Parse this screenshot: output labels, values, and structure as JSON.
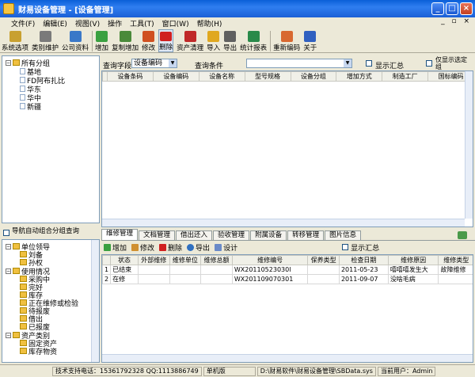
{
  "window": {
    "title": "财易设备管理 - [设备管理]"
  },
  "menu": [
    "文件(F)",
    "编辑(E)",
    "视图(V)",
    "操作",
    "工具(T)",
    "窗口(W)",
    "帮助(H)"
  ],
  "toolbar": [
    {
      "label": "系统选项",
      "icon": "gear-icon",
      "color": "#c8a030"
    },
    {
      "label": "类别维护",
      "icon": "tools-icon",
      "color": "#7a7a7a"
    },
    {
      "label": "公司资料",
      "icon": "people-icon",
      "color": "#3a78c8"
    },
    {
      "label": "增加",
      "icon": "add-icon",
      "color": "#3aa040"
    },
    {
      "label": "复制增加",
      "icon": "copy-icon",
      "color": "#4a8a3a"
    },
    {
      "label": "修改",
      "icon": "pen-icon",
      "color": "#d05020"
    },
    {
      "label": "删除",
      "icon": "delete-icon",
      "color": "#d02020"
    },
    {
      "label": "资产清理",
      "icon": "clear-icon",
      "color": "#c02828"
    },
    {
      "label": "导入",
      "icon": "import-icon",
      "color": "#e0a820"
    },
    {
      "label": "导出",
      "icon": "export-icon",
      "color": "#606060"
    },
    {
      "label": "统计报表",
      "icon": "chart-icon",
      "color": "#2a8a4a"
    },
    {
      "label": "重新编码",
      "icon": "recode-icon",
      "color": "#d86830"
    },
    {
      "label": "关于",
      "icon": "help-icon",
      "color": "#3060c0"
    }
  ],
  "tree_top": {
    "root": "所有分组",
    "children": [
      "基地",
      "FD阿布扎比",
      "华东",
      "华中",
      "新疆"
    ]
  },
  "query": {
    "field_label": "查询字段",
    "field_value": "设备编码",
    "cond_label": "查询条件",
    "cond_value": "",
    "summary_label": "显示汇总",
    "only_selected_label": "仅显示选定组"
  },
  "main_table": {
    "columns": [
      "设备条码",
      "设备编码",
      "设备名称",
      "型号规格",
      "设备分组",
      "增加方式",
      "制造工厂",
      "国标编码"
    ]
  },
  "left_bottom": {
    "nav_label": "导航自动组合分组查询",
    "groups": [
      {
        "name": "单位领导",
        "items": [
          "刘备",
          "孙权"
        ]
      },
      {
        "name": "使用情况",
        "items": [
          "采购中",
          "完好",
          "库存",
          "正在维修或检验",
          "待报废",
          "借出",
          "已报废"
        ]
      },
      {
        "name": "资产类别",
        "items": [
          "固定资产",
          "库存物资"
        ]
      }
    ]
  },
  "tabs": [
    "维修管理",
    "文档管理",
    "借出还入",
    "验收管理",
    "附属设备",
    "转移管理",
    "图片信息"
  ],
  "sub_toolbar": [
    "增加",
    "修改",
    "删除",
    "导出",
    "设计"
  ],
  "sub_summary_label": "显示汇总",
  "repair_table": {
    "columns": [
      "状态",
      "外部维修",
      "维修单位",
      "维修总额",
      "维修编号",
      "保养类型",
      "检查日期",
      "维修原因",
      "维修类型"
    ],
    "rows": [
      {
        "no": "1",
        "cells": [
          "已结束",
          "",
          "",
          "",
          "WX20110523030l",
          "",
          "2011-05-23",
          "嘻嘻嘻发生大",
          "故障维修"
        ]
      },
      {
        "no": "2",
        "cells": [
          "在修",
          "",
          "",
          "",
          "WX201109070301",
          "",
          "2011-09-07",
          "没啥毛病",
          ""
        ]
      }
    ]
  },
  "status": {
    "support": "技术支持电话：15361792328 QQ:1113886749",
    "mode": "单机版",
    "path": "D:\\财易软件\\财易设备管理\\SBData.sys",
    "user": "当前用户：Admin"
  }
}
